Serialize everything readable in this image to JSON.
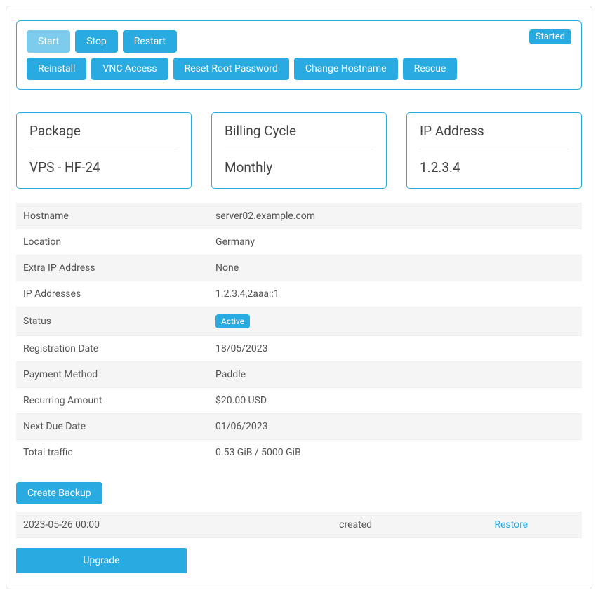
{
  "status_badge": "Started",
  "controls": {
    "start": "Start",
    "stop": "Stop",
    "restart": "Restart",
    "reinstall": "Reinstall",
    "vnc": "VNC Access",
    "reset_pw": "Reset Root Password",
    "change_host": "Change Hostname",
    "rescue": "Rescue"
  },
  "cards": {
    "package_label": "Package",
    "package_value": "VPS - HF-24",
    "billing_label": "Billing Cycle",
    "billing_value": "Monthly",
    "ip_label": "IP Address",
    "ip_value": "1.2.3.4"
  },
  "details": [
    {
      "label": "Hostname",
      "value": "server02.example.com"
    },
    {
      "label": "Location",
      "value": "Germany"
    },
    {
      "label": "Extra IP Address",
      "value": "None"
    },
    {
      "label": "IP Addresses",
      "value": "1.2.3.4,2aaa::1"
    },
    {
      "label": "Status",
      "value": "Active",
      "is_badge": true
    },
    {
      "label": "Registration Date",
      "value": "18/05/2023"
    },
    {
      "label": "Payment Method",
      "value": "Paddle"
    },
    {
      "label": "Recurring Amount",
      "value": "$20.00 USD"
    },
    {
      "label": "Next Due Date",
      "value": "01/06/2023"
    },
    {
      "label": "Total traffic",
      "value": "0.53 GiB / 5000 GiB"
    }
  ],
  "backup": {
    "create_label": "Create Backup",
    "rows": [
      {
        "date": "2023-05-26 00:00",
        "status": "created",
        "action": "Restore"
      }
    ]
  },
  "upgrade_label": "Upgrade"
}
